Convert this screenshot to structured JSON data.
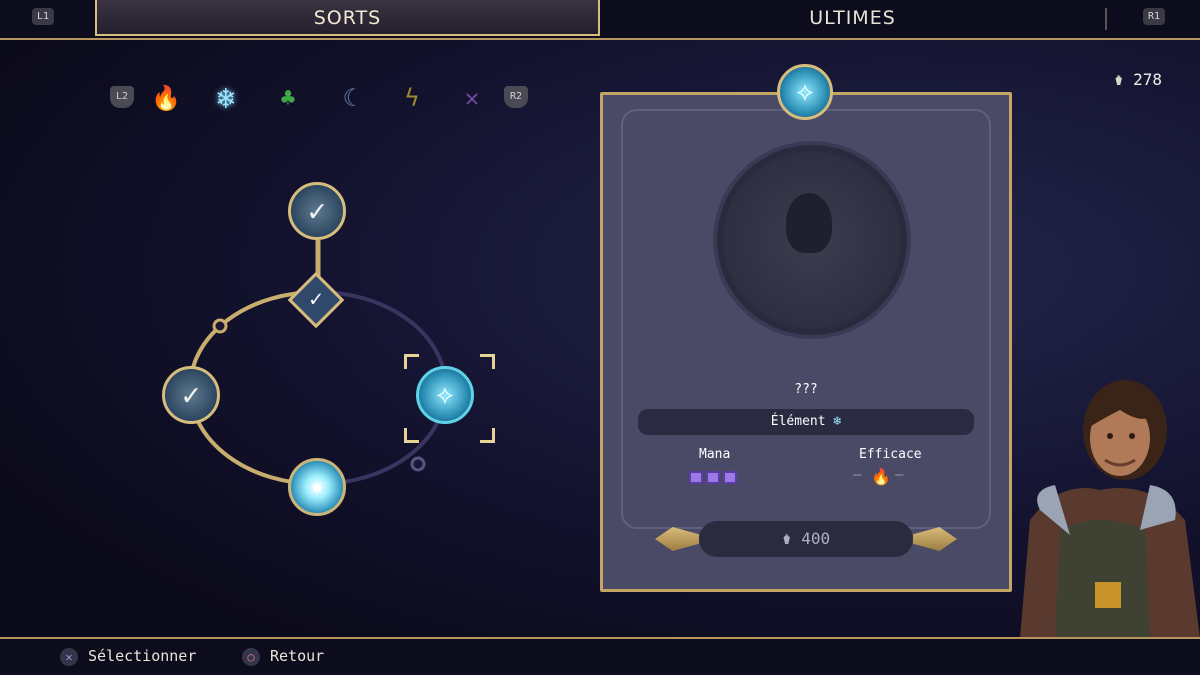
{
  "tabs": {
    "left_button": "L1",
    "right_button": "R1",
    "items": [
      {
        "label": "SORTS",
        "active": true
      },
      {
        "label": "ULTIMES",
        "active": false
      }
    ]
  },
  "element_bar": {
    "left_button": "L2",
    "right_button": "R2",
    "elements": [
      {
        "icon": "fire-element-icon",
        "glyph": "🔥",
        "color": "#e38b2c"
      },
      {
        "icon": "ice-element-icon",
        "glyph": "❄",
        "color": "#9fe6ff",
        "selected": true
      },
      {
        "icon": "nature-element-icon",
        "glyph": "♣",
        "color": "#3fa844"
      },
      {
        "icon": "wind-element-icon",
        "glyph": "☾",
        "color": "#6a7fa8"
      },
      {
        "icon": "lightning-element-icon",
        "glyph": "ϟ",
        "color": "#a28a2a"
      },
      {
        "icon": "void-element-icon",
        "glyph": "✕",
        "color": "#6a4a9a"
      }
    ]
  },
  "currency": {
    "icon": "essence-bag-icon",
    "glyph": "⚱",
    "value": "278"
  },
  "skill_tree": {
    "nodes": [
      {
        "id": "top",
        "state": "learned",
        "glyph": "✓"
      },
      {
        "id": "diamond",
        "state": "learned",
        "glyph": "✓"
      },
      {
        "id": "left",
        "state": "learned",
        "glyph": "✓"
      },
      {
        "id": "right",
        "state": "selected",
        "glyph": "⟡"
      },
      {
        "id": "bottom",
        "state": "active",
        "glyph": "✷"
      }
    ]
  },
  "detail_panel": {
    "spell_glyph": "⟡",
    "name": "???",
    "element_label": "Élément",
    "element_glyph": "❄",
    "mana_label": "Mana",
    "mana_cost": 3,
    "efficace_label": "Efficace",
    "efficace_glyph": "🔥",
    "cost_glyph": "⚱",
    "cost": "400"
  },
  "footer": {
    "select_label": "Sélectionner",
    "back_label": "Retour"
  },
  "colors": {
    "gold": "#d6bd7e",
    "panel": "#4a4a66",
    "mana": "#9b7ae8"
  }
}
